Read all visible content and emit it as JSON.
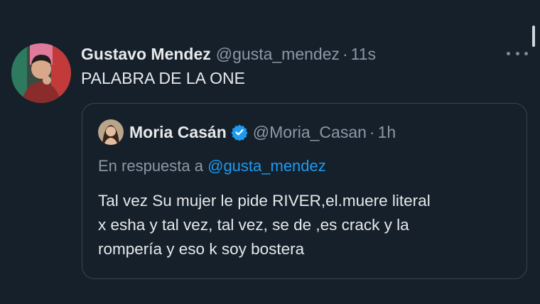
{
  "tweet": {
    "author_name": "Gustavo Mendez",
    "author_handle": "@gusta_mendez",
    "separator": "·",
    "time": "11s",
    "text": "PALABRA DE LA ONE"
  },
  "quoted_tweet": {
    "author_name": "Moria Casán",
    "author_handle": "@Moria_Casan",
    "separator": "·",
    "time": "1h",
    "verified": true,
    "reply_prefix": "En respuesta a",
    "reply_mention": "@gusta_mendez",
    "text_lines": [
      "Tal vez Su mujer le pide RIVER,el.muere literal",
      "x esha y tal vez, tal vez, se de ,es crack y la",
      "rompería y eso k soy bostera"
    ]
  },
  "icons": {
    "more": "more-horizontal-icon",
    "verified": "verified-badge-icon"
  },
  "colors": {
    "background": "#15202b",
    "text": "#e7e9ea",
    "muted": "#8b98a5",
    "link": "#1d9bf0",
    "border": "#38444d"
  }
}
